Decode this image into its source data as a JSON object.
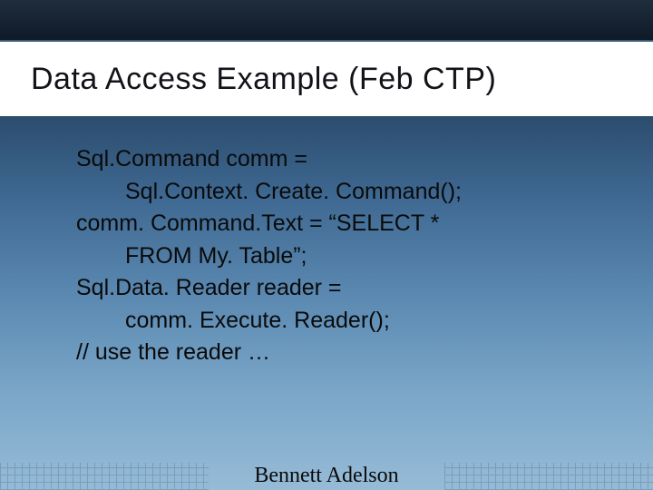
{
  "slide": {
    "title": "Data Access Example (Feb CTP)",
    "code": {
      "l1": "Sql.Command comm =",
      "l2": "Sql.Context. Create. Command();",
      "l3": "comm. Command.Text = “SELECT *",
      "l4": "FROM My. Table”;",
      "l5": "Sql.Data. Reader reader =",
      "l6": "comm. Execute. Reader();",
      "l7": "// use the reader …"
    },
    "footer": "Bennett Adelson"
  }
}
